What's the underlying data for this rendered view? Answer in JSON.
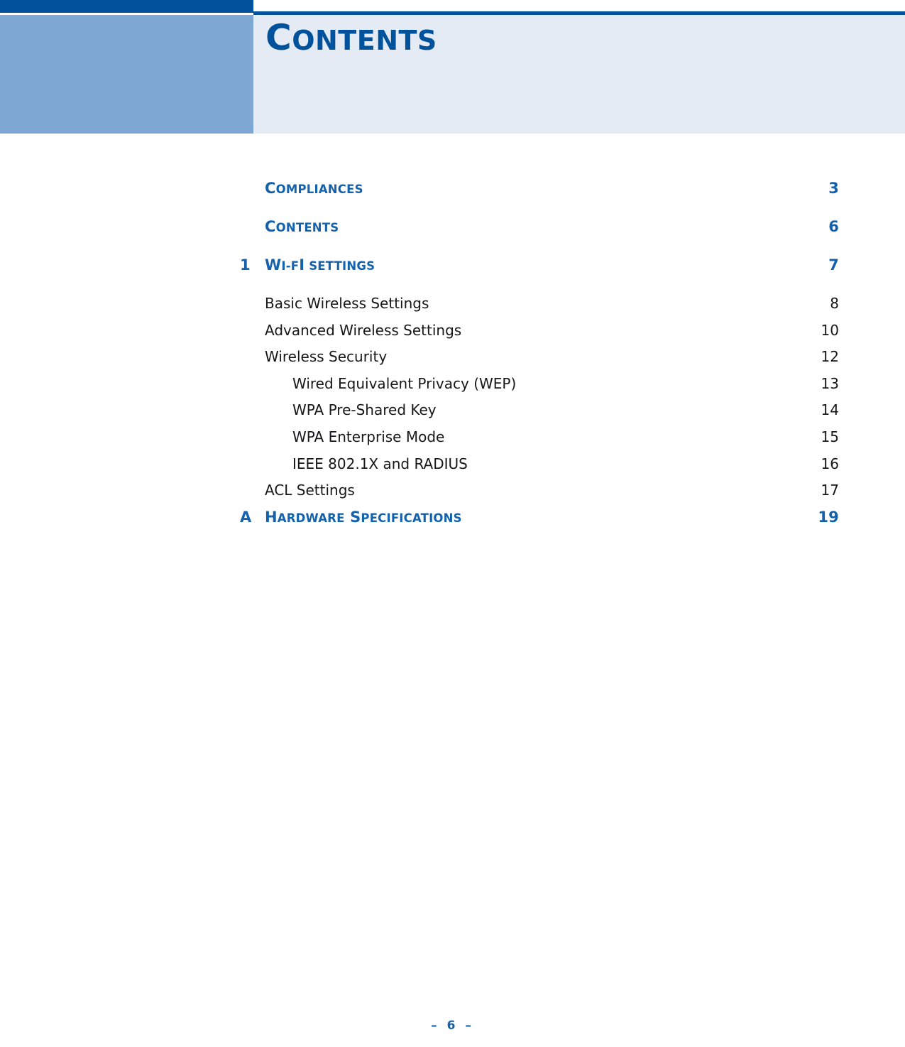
{
  "header": {
    "title_lead": "C",
    "title_rest": "ONTENTS",
    "accent_dark": "#01529c",
    "accent_mid": "#7ea7d3",
    "panel_light": "#e4ebf4",
    "link_blue": "#1461ac"
  },
  "toc": {
    "entries": [
      {
        "level": 1,
        "number": "",
        "lead": "C",
        "rest": "OMPLIANCES",
        "label": "COMPLIANCES",
        "page": "3"
      },
      {
        "level": 1,
        "number": "",
        "lead": "C",
        "rest": "ONTENTS",
        "label": "CONTENTS",
        "page": "6"
      },
      {
        "level": 1,
        "number": "1",
        "lead": "W",
        "rest": "I-F",
        "lead2": "I",
        "rest2": " S",
        "rest3": "ETTINGS",
        "label": "WI-FI SETTINGS",
        "page": "7"
      },
      {
        "level": 2,
        "number": "",
        "label": "Basic Wireless Settings",
        "page": "8"
      },
      {
        "level": 2,
        "number": "",
        "label": "Advanced Wireless Settings",
        "page": "10"
      },
      {
        "level": 2,
        "number": "",
        "label": "Wireless Security",
        "page": "12"
      },
      {
        "level": 3,
        "number": "",
        "label": "Wired Equivalent Privacy (WEP)",
        "page": "13"
      },
      {
        "level": 3,
        "number": "",
        "label": "WPA Pre-Shared Key",
        "page": "14"
      },
      {
        "level": 3,
        "number": "",
        "label": "WPA Enterprise Mode",
        "page": "15"
      },
      {
        "level": 3,
        "number": "",
        "label": "IEEE 802.1X and RADIUS",
        "page": "16"
      },
      {
        "level": 2,
        "number": "",
        "label": "ACL Settings",
        "page": "17"
      },
      {
        "level": 1,
        "number": "A",
        "lead": "H",
        "rest": "ARDWARE",
        "lead2": " S",
        "rest2": "PECIFICATIONS",
        "label": "HARDWARE SPECIFICATIONS",
        "page": "19"
      }
    ]
  },
  "footer": {
    "page_marker": "–  6  –"
  }
}
